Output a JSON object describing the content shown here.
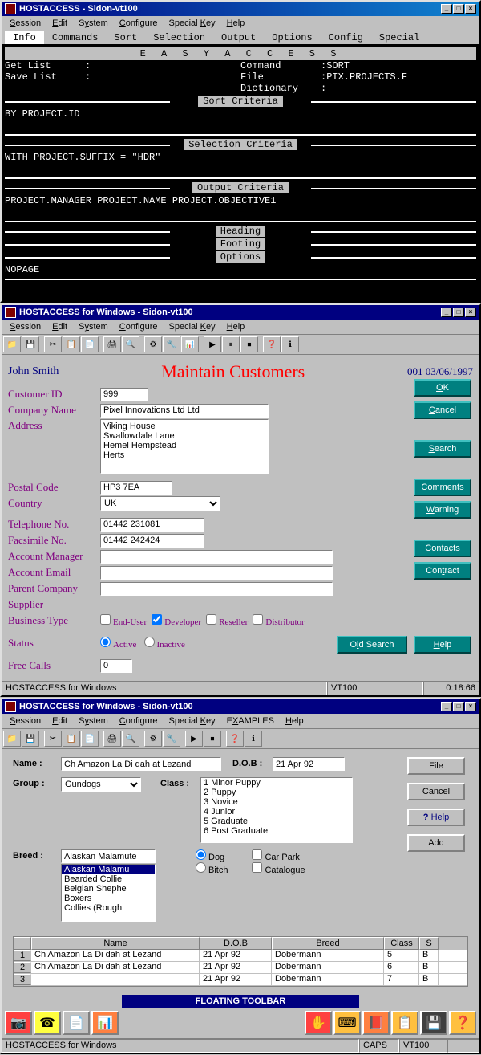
{
  "win1": {
    "title": "HOSTACCESS - Sidon-vt100",
    "menu": [
      "Session",
      "Edit",
      "System",
      "Configure",
      "Special Key",
      "Help"
    ],
    "term_menu": [
      "Info",
      "Commands",
      "Sort",
      "Selection",
      "Output",
      "Options",
      "Config",
      "Special"
    ],
    "banner": "E A S Y   A C C E S S",
    "get_list": "Get List",
    "save_list": "Save List",
    "command_lbl": "Command",
    "command_val": "SORT",
    "file_lbl": "File",
    "file_val": "PIX.PROJECTS.F",
    "dict_lbl": "Dictionary",
    "sort_crit": "Sort Criteria",
    "sort_val": "BY PROJECT.ID",
    "sel_crit": "Selection Criteria",
    "sel_val": "WITH PROJECT.SUFFIX = \"HDR\"",
    "out_crit": "Output Criteria",
    "out_val": "PROJECT.MANAGER PROJECT.NAME PROJECT.OBJECTIVE1",
    "heading": "Heading",
    "footing": "Footing",
    "options": "Options",
    "nopage": "NOPAGE"
  },
  "win2": {
    "title": "HOSTACCESS for Windows - Sidon-vt100",
    "menu": [
      "Session",
      "Edit",
      "System",
      "Configure",
      "Special Key",
      "Help"
    ],
    "user": "John Smith",
    "page_title": "Maintain Customers",
    "date": "001 03/06/1997",
    "labels": {
      "cust_id": "Customer ID",
      "company": "Company Name",
      "address": "Address",
      "postal": "Postal Code",
      "country": "Country",
      "tel": "Telephone No.",
      "fax": "Facsimile No.",
      "acct_mgr": "Account Manager",
      "acct_email": "Account Email",
      "parent": "Parent Company",
      "supplier": "Supplier",
      "biz_type": "Business Type",
      "status": "Status",
      "free_calls": "Free Calls"
    },
    "values": {
      "cust_id": "999",
      "company": "Pixel Innovations Ltd Ltd",
      "address": "Viking House\nSwallowdale Lane\nHemel Hempstead\nHerts",
      "postal": "HP3 7EA",
      "country": "UK",
      "tel": "01442 231081",
      "fax": "01442 242424",
      "free_calls": "0"
    },
    "biz_types": [
      "End-User",
      "Developer",
      "Reseller",
      "Distributor"
    ],
    "status_opts": [
      "Active",
      "Inactive"
    ],
    "buttons": [
      "OK",
      "Cancel",
      "Search",
      "Comments",
      "Warning",
      "Contacts",
      "Contract",
      "Old Search",
      "Help"
    ],
    "status_left": "HOSTACCESS for Windows",
    "status_mid": "VT100",
    "status_right": "0:18:66"
  },
  "win3": {
    "title": "HOSTACCESS for Windows - Sidon-vt100",
    "menu": [
      "Session",
      "Edit",
      "System",
      "Configure",
      "Special Key",
      "EXAMPLES",
      "Help"
    ],
    "labels": {
      "name": "Name :",
      "dob": "D.O.B :",
      "group": "Group :",
      "class": "Class :",
      "breed": "Breed :"
    },
    "name_val": "Ch Amazon La Di dah at Lezand",
    "dob_val": "21 Apr 92",
    "group_val": "Gundogs",
    "classes": [
      "1  Minor Puppy",
      "2  Puppy",
      "3  Novice",
      "4  Junior",
      "5  Graduate",
      "6  Post Graduate"
    ],
    "breed_val": "Alaskan Malamute",
    "breeds": [
      "Alaskan Malamu",
      "Bearded Collie",
      "Belgian Shephe",
      "Boxers",
      "Collies (Rough"
    ],
    "radio": [
      "Dog",
      "Bitch"
    ],
    "checks": [
      "Car Park",
      "Catalogue"
    ],
    "buttons": {
      "file": "File",
      "cancel": "Cancel",
      "help": "? Help",
      "add": "Add"
    },
    "grid_head": [
      "",
      "Name",
      "D.O.B",
      "Breed",
      "Class",
      "S"
    ],
    "grid_rows": [
      [
        "1",
        "Ch Amazon La Di dah at Lezand",
        "21 Apr 92",
        "Dobermann",
        "5",
        "B"
      ],
      [
        "2",
        "Ch Amazon La Di dah at Lezand",
        "21 Apr 92",
        "Dobermann",
        "6",
        "B"
      ],
      [
        "3",
        "",
        "21 Apr 92",
        "Dobermann",
        "7",
        "B"
      ]
    ],
    "float_title": "FLOATING TOOLBAR",
    "status_left": "HOSTACCESS for Windows",
    "status_caps": "CAPS",
    "status_vt": "VT100"
  }
}
